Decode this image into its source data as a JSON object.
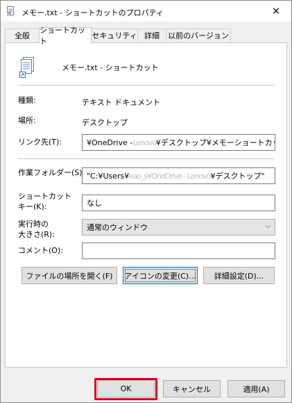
{
  "window": {
    "title": "メモー.txt - ショートカットのプロパティ",
    "close_icon": "close-icon"
  },
  "tabs": [
    {
      "label": "全般"
    },
    {
      "label": "ショートカット"
    },
    {
      "label": "セキュリティ"
    },
    {
      "label": "詳細"
    },
    {
      "label": "以前のバージョン"
    }
  ],
  "shortcut": {
    "name": "メモー.txt - ショートカット"
  },
  "fields": {
    "type_label": "種類:",
    "type_value": "テキスト ドキュメント",
    "location_label": "場所:",
    "location_value": "デスクトップ",
    "target_label": "リンク先(T):",
    "target_value_prefix": "¥OneDrive - ",
    "target_value_blur": "Lenovo",
    "target_value_suffix": "¥デスクトップ¥メモーショートカット.txt\"",
    "startin_label": "作業フォルダー(S):",
    "startin_value_prefix": "\"C:¥Users¥",
    "startin_value_blur": "kao_s¥OneDrive - Lenovo",
    "startin_value_suffix": "¥デスクトップ\"",
    "hotkey_label_line1": "ショートカット",
    "hotkey_label_line2": "キー(K):",
    "hotkey_value": "なし",
    "run_label_line1": "実行時の",
    "run_label_line2": "大きさ(R):",
    "run_value": "通常のウィンドウ",
    "comment_label": "コメント(O):",
    "comment_value": ""
  },
  "buttons": {
    "open_location": "ファイルの場所を開く(F)",
    "change_icon": "アイコンの変更(C)...",
    "advanced": "詳細設定(D)...",
    "ok": "OK",
    "cancel": "キャンセル",
    "apply": "適用(A)"
  },
  "colors": {
    "highlight": "#e0001a",
    "focus": "#0078d7"
  }
}
